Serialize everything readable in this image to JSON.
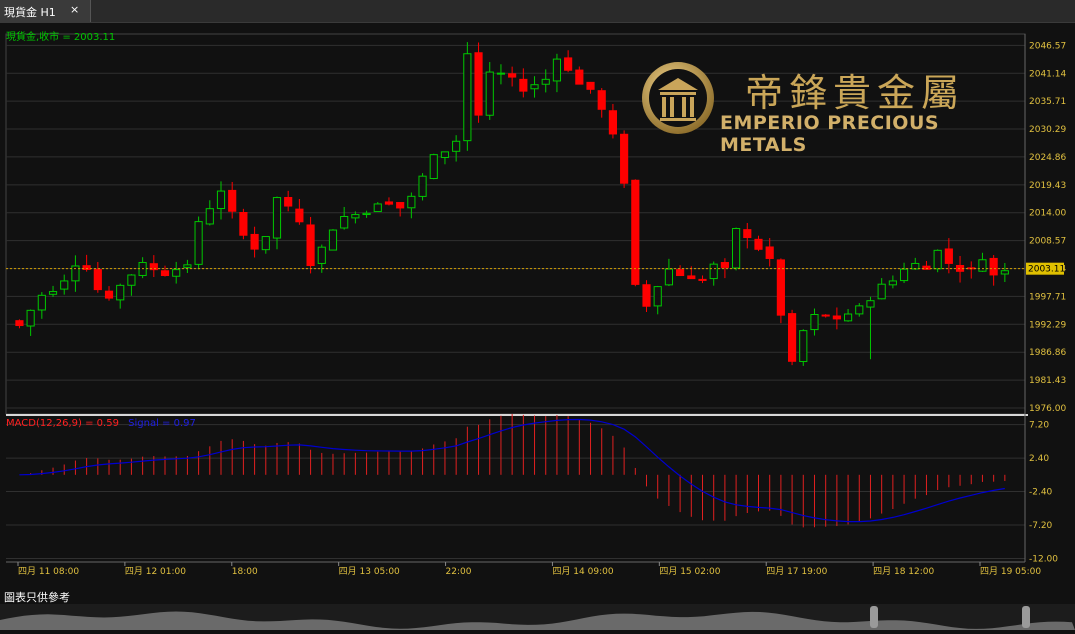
{
  "tab": {
    "label": "現貨金 H1",
    "close_icon": "×"
  },
  "footer": {
    "note": "圖表只供參考"
  },
  "logo": {
    "chinese": "帝鋒貴金屬",
    "english": "EMPERIO PRECIOUS METALS",
    "emblem_icon": "pillar-emblem-icon"
  },
  "colors": {
    "up": "#00c800",
    "down": "#ff0000",
    "macd_hist": "#e02020",
    "signal": "#0000d0",
    "axis_text": "#e0c040",
    "current_line": "#d4a000"
  },
  "chart_data": [
    {
      "type": "candlestick",
      "legend": "現貨金,收市 = 2003.11",
      "current_price": 2003.11,
      "current_price_label": "2003.11",
      "y_ticks": [
        "2046.57",
        "2041.14",
        "2035.71",
        "2030.29",
        "2024.86",
        "2019.43",
        "2014.00",
        "2008.57",
        "2003.14",
        "1997.71",
        "1992.29",
        "1986.86",
        "1981.43",
        "1976.00"
      ],
      "x_ticks": [
        "四月 11 08:00",
        "四月 12 01:00",
        "18:00",
        "四月 13 05:00",
        "22:00",
        "四月 14 09:00",
        "四月 15 02:00",
        "四月 17 19:00",
        "四月 18 12:00",
        "四月 19 05:00"
      ],
      "ylim": [
        1976.0,
        2048.0
      ],
      "grid": true,
      "close_path": [
        1993,
        1992,
        1995,
        1998,
        1999,
        2001,
        2004,
        2003,
        1999,
        1997,
        2000,
        2002,
        2004,
        2003,
        2002,
        2003,
        2004,
        2012,
        2015,
        2018,
        2014,
        2010,
        2007,
        2009,
        2017,
        2015,
        2012,
        2004,
        2007,
        2011,
        2013,
        2014,
        2014,
        2016,
        2016,
        2015,
        2017,
        2021,
        2025,
        2026,
        2028,
        2045,
        2033,
        2041,
        2041,
        2040,
        2038,
        2039,
        2040,
        2044,
        2042,
        2039,
        2038,
        2034,
        2029,
        2020,
        2000,
        1996,
        2000,
        2003,
        2002,
        2001,
        2001,
        2004,
        2003,
        2011,
        2009,
        2007,
        2005,
        1994,
        1985,
        1991,
        1994,
        1994,
        1993,
        1994,
        1996,
        1997,
        2000,
        2001,
        2003,
        2004,
        2003,
        2007,
        2004,
        2003,
        2003,
        2005,
        2002,
        2003
      ]
    },
    {
      "type": "bar",
      "legend_macd": "MACD(12,26,9) = 0.59",
      "legend_signal": "Signal = 0.97",
      "macd_value": 0.59,
      "signal_value": 0.97,
      "y_ticks": [
        "7.20",
        "2.40",
        "-2.40",
        "-7.20",
        "-12.00"
      ],
      "ylim": [
        -12.5,
        8.0
      ]
    }
  ]
}
